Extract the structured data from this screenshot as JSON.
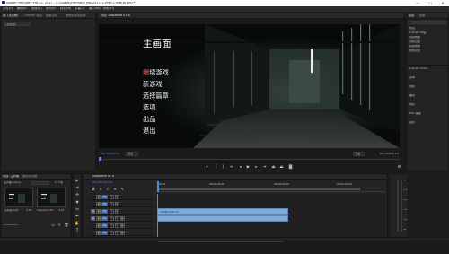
{
  "window": {
    "title": "Adobe Premiere Pro CC 2017 - C:\\Users\\Premiere Pro\\2017\\主界面\\主界面.prproj *",
    "controls": [
      "—",
      "☐",
      "✕"
    ]
  },
  "menus": [
    "文件(F)",
    "编辑(E)",
    "剪辑(C)",
    "序列(S)",
    "标记(M)",
    "字幕(T)",
    "窗口(W)",
    "帮助(H)"
  ],
  "source_panel": {
    "tabs": [
      "源: (无剪辑)",
      "Lumetri 范围",
      "效果控件",
      "音频剪辑混合器"
    ],
    "field_label": "(无剪辑)"
  },
  "program_panel": {
    "tab": "节目: Sequence 01 ≡",
    "timecode_left": "00;00;00;00",
    "fit": "适合",
    "quality": "完整",
    "timecode_right": "00;00;03;13"
  },
  "video_frame": {
    "title": "主画面",
    "items": [
      {
        "label": "继续游戏",
        "highlight": "继"
      },
      {
        "label": "新游戏"
      },
      {
        "label": "选择篇章"
      },
      {
        "label": "选项"
      },
      {
        "label": "出品"
      },
      {
        "label": "退出"
      }
    ]
  },
  "right_panel": {
    "tabs": [
      "信息",
      "效果"
    ],
    "search_placeholder": "",
    "tree": [
      "预设",
      "Lumetri 预设",
      "音频效果",
      "音频过渡",
      "视频效果",
      "视频过渡"
    ],
    "sections": [
      "Lumetri Color",
      "基本",
      "创意",
      "曲线",
      "色轮",
      "HSL 辅助",
      "晕影"
    ]
  },
  "project_panel": {
    "tabs": [
      "项目: 主界面",
      "媒体浏览器"
    ],
    "file": "主界面.prproj",
    "count": "2 个项",
    "items": [
      {
        "name": "主界面.mp4",
        "duration": "3;13"
      },
      {
        "name": "Sequence 01",
        "duration": "3;13"
      }
    ]
  },
  "tools": [
    {
      "name": "selection-tool",
      "glyph": "▶"
    },
    {
      "name": "track-select-tool",
      "glyph": "⇉"
    },
    {
      "name": "ripple-edit-tool",
      "glyph": "✣"
    },
    {
      "name": "razor-tool",
      "glyph": "◆"
    },
    {
      "name": "slip-tool",
      "glyph": "⇔"
    },
    {
      "name": "pen-tool",
      "glyph": "✒"
    },
    {
      "name": "hand-tool",
      "glyph": "✋"
    },
    {
      "name": "type-tool",
      "glyph": "T"
    }
  ],
  "timeline": {
    "tab": "Sequence 01 ≡",
    "timecode": "00;00;00;00",
    "ruler": [
      ":00;00",
      "00;00;01;00",
      "00;00;02;00",
      "00;00;03;00"
    ],
    "video_tracks": [
      "V3",
      "V2",
      "V1"
    ],
    "audio_tracks": [
      "A1",
      "A2",
      "A3"
    ],
    "clip_label": "主界面.mp4 [V]",
    "db_labels": [
      "0",
      "-12",
      "-24",
      "-36",
      "-48",
      "dB"
    ]
  },
  "colors": {
    "accent": "#4b8fe8",
    "clip": "#7fa8d6",
    "highlight": "#ff5b4a"
  }
}
